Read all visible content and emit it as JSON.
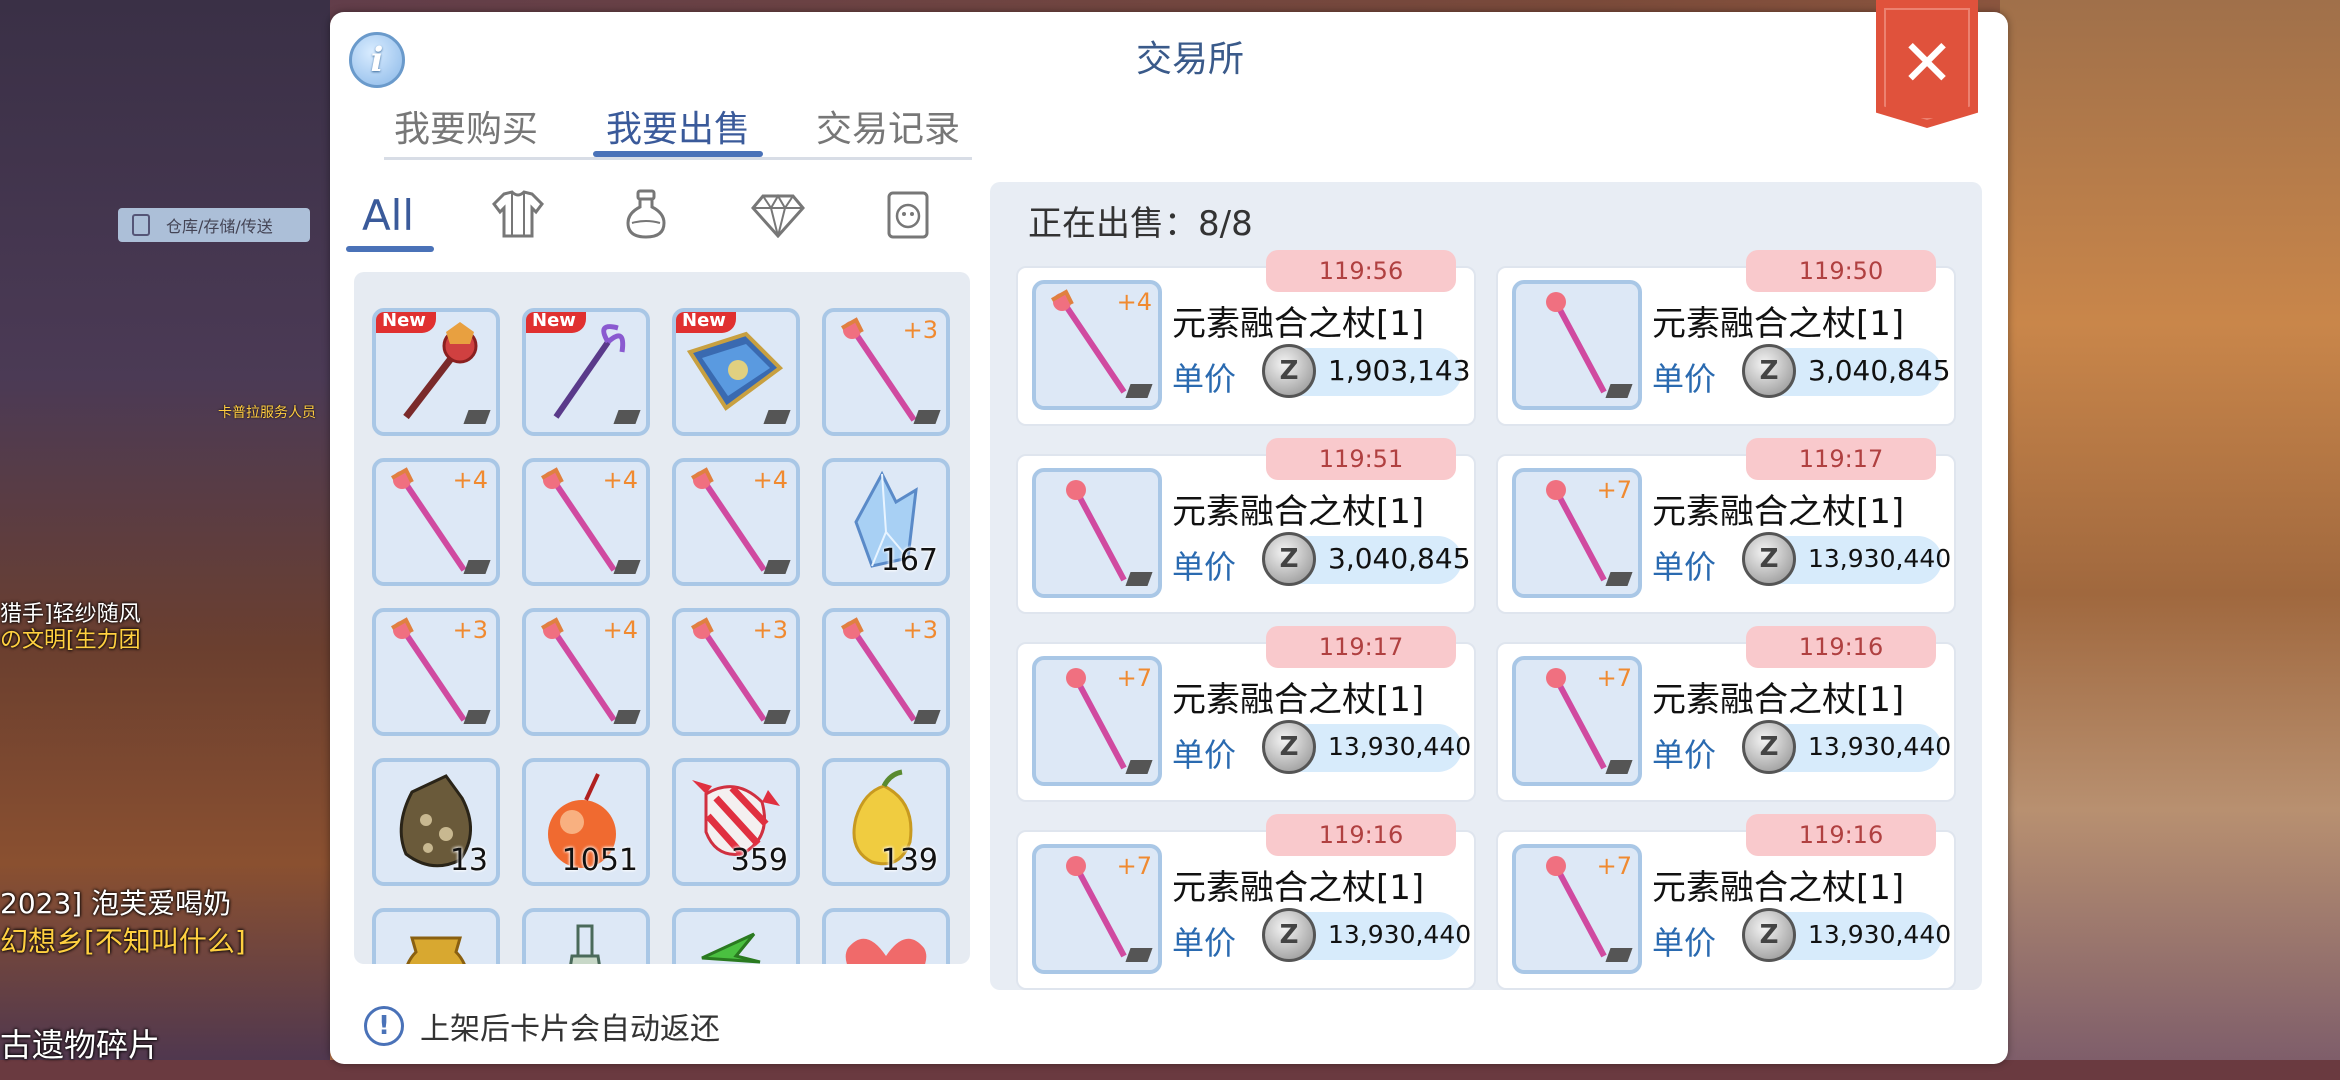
{
  "hud": {
    "world_button": "仓库/存储/传送",
    "npc_name": "卡普拉服务人员",
    "player1_line1": "猎手]轻纱随风",
    "player1_line2": "の文明[生力团",
    "player2_line1": "2023] 泡芙爱喝奶",
    "player2_line2": "幻想乡[不知叫什么]",
    "bottom_text": "古遗物碎片"
  },
  "header": {
    "title": "交易所",
    "info_label": "i",
    "close_label": "✕"
  },
  "tabs": [
    "我要购买",
    "我要出售",
    "交易记录"
  ],
  "active_tab": "我要出售",
  "filters": {
    "all": "All",
    "icons": [
      "armor-icon",
      "potion-icon",
      "gem-icon",
      "card-icon"
    ]
  },
  "inventory": {
    "new_label": "New",
    "slots": [
      {
        "item": "red-staff",
        "new": true,
        "plus": "",
        "count": ""
      },
      {
        "item": "purple-staff",
        "new": true,
        "plus": "",
        "count": ""
      },
      {
        "item": "blue-book",
        "new": true,
        "plus": "",
        "count": ""
      },
      {
        "item": "pink-staff",
        "new": false,
        "plus": "+3",
        "count": ""
      },
      {
        "item": "pink-staff",
        "new": false,
        "plus": "+4",
        "count": ""
      },
      {
        "item": "pink-staff",
        "new": false,
        "plus": "+4",
        "count": ""
      },
      {
        "item": "pink-staff",
        "new": false,
        "plus": "+4",
        "count": ""
      },
      {
        "item": "ice-crystal",
        "new": false,
        "plus": "",
        "count": "167"
      },
      {
        "item": "pink-staff",
        "new": false,
        "plus": "+3",
        "count": ""
      },
      {
        "item": "pink-staff",
        "new": false,
        "plus": "+4",
        "count": ""
      },
      {
        "item": "pink-staff",
        "new": false,
        "plus": "+3",
        "count": ""
      },
      {
        "item": "pink-staff",
        "new": false,
        "plus": "+3",
        "count": ""
      },
      {
        "item": "dark-pouch",
        "new": false,
        "plus": "",
        "count": "13"
      },
      {
        "item": "red-fruit",
        "new": false,
        "plus": "",
        "count": "1051"
      },
      {
        "item": "candy",
        "new": false,
        "plus": "",
        "count": "359"
      },
      {
        "item": "yellow-fruit",
        "new": false,
        "plus": "",
        "count": "139"
      },
      {
        "item": "golden-pot",
        "new": false,
        "plus": "",
        "count": ""
      },
      {
        "item": "bottle",
        "new": false,
        "plus": "",
        "count": ""
      },
      {
        "item": "green-leaf",
        "new": false,
        "plus": "",
        "count": ""
      },
      {
        "item": "red-heart",
        "new": false,
        "plus": "",
        "count": ""
      }
    ]
  },
  "selling": {
    "header": "正在出售：8/8",
    "price_label": "单价",
    "coin_label": "Z",
    "items": [
      {
        "time": "119:56",
        "name": "元素融合之杖[1]",
        "plus": "+4",
        "price": "1,903,143"
      },
      {
        "time": "119:50",
        "name": "元素融合之杖[1]",
        "plus": "",
        "price": "3,040,845"
      },
      {
        "time": "119:51",
        "name": "元素融合之杖[1]",
        "plus": "",
        "price": "3,040,845"
      },
      {
        "time": "119:17",
        "name": "元素融合之杖[1]",
        "plus": "+7",
        "price": "13,930,440"
      },
      {
        "time": "119:17",
        "name": "元素融合之杖[1]",
        "plus": "+7",
        "price": "13,930,440"
      },
      {
        "time": "119:16",
        "name": "元素融合之杖[1]",
        "plus": "+7",
        "price": "13,930,440"
      },
      {
        "time": "119:16",
        "name": "元素融合之杖[1]",
        "plus": "+7",
        "price": "13,930,440"
      },
      {
        "time": "119:16",
        "name": "元素融合之杖[1]",
        "plus": "+7",
        "price": "13,930,440"
      }
    ]
  },
  "notice": "上架后卡片会自动返还"
}
